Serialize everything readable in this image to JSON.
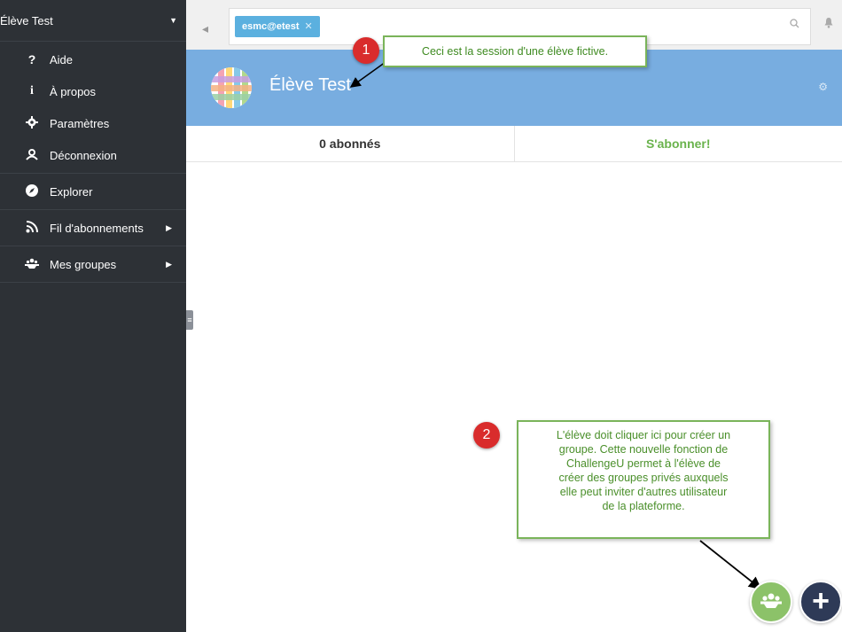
{
  "sidebar": {
    "user_name": "Élève Test",
    "items": [
      {
        "label": "Aide",
        "icon": "question-icon"
      },
      {
        "label": "À propos",
        "icon": "info-icon"
      },
      {
        "label": "Paramètres",
        "icon": "gear-icon"
      },
      {
        "label": "Déconnexion",
        "icon": "logout-icon"
      }
    ],
    "sections": [
      {
        "label": "Explorer",
        "icon": "compass-icon"
      },
      {
        "label": "Fil d'abonnements",
        "icon": "rss-icon"
      },
      {
        "label": "Mes groupes",
        "icon": "group-icon"
      }
    ]
  },
  "topbar": {
    "search_tag": "esmc@etest"
  },
  "profile": {
    "name": "Élève Test"
  },
  "tabs": {
    "subscribers": "0 abonnés",
    "subscribe": "S'abonner!"
  },
  "annotations": {
    "n1": "1",
    "n2": "2",
    "callout1": "Ceci est la session d'une élève fictive.",
    "callout2_lines": [
      "L'élève doit cliquer ici pour créer un",
      "groupe. Cette nouvelle fonction de",
      "ChallengeU permet à l'élève de",
      "créer des groupes privés auxquels",
      "elle peut inviter d'autres utilisateur",
      "de la plateforme."
    ]
  },
  "colors": {
    "sidebar": "#2d3136",
    "banner": "#78ade0",
    "tag": "#5bb0df",
    "accent_green": "#6ab34d",
    "fab_group": "#8cc269",
    "fab_add": "#2e3a57",
    "badge_red": "#d92c2c"
  }
}
